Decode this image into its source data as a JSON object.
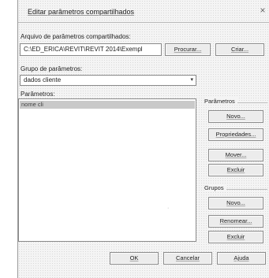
{
  "dialog": {
    "title": "Editar parâmetros compartilhados",
    "close_glyph": "×"
  },
  "file_section": {
    "label": "Arquivo de parâmetros compartilhados:",
    "path_value": "C:\\ED_ERICA\\REVIT\\REVIT 2014\\Exempl",
    "browse_label": "Procurar...",
    "create_label": "Criar..."
  },
  "group_section": {
    "label": "Grupo de parâmetros:",
    "selected_value": "dados cliente",
    "arrow_glyph": "▾"
  },
  "parameters_section": {
    "label": "Parâmetros:",
    "items": [
      "nome cli"
    ]
  },
  "parameters_panel": {
    "title": "Parâmetros",
    "new_label": "Novo...",
    "properties_label": "Propriedades...",
    "move_label": "Mover...",
    "delete_label": "Excluir"
  },
  "groups_panel": {
    "title": "Grupos",
    "new_label": "Novo...",
    "rename_label": "Renomear...",
    "delete_label": "Excluir"
  },
  "footer": {
    "ok_label": "OK",
    "cancel_label": "Cancelar",
    "help_label": "Ajuda"
  }
}
